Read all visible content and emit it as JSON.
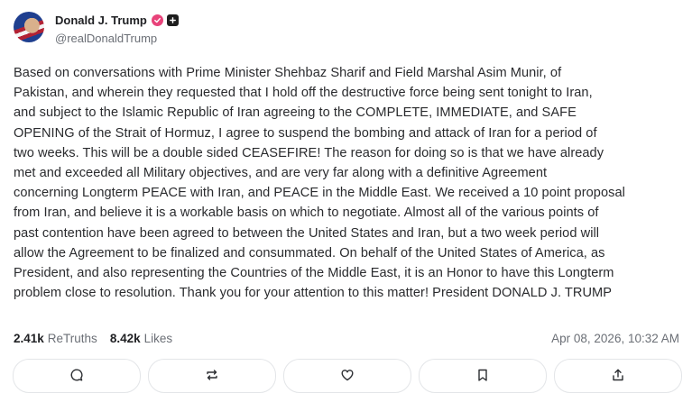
{
  "user": {
    "display_name": "Donald J. Trump",
    "handle": "@realDonaldTrump",
    "avatar_icon": "avatar-flag-portrait",
    "verified_icon": "verified-badge-icon",
    "verified_color": "#e8437a",
    "badge_icon": "plus-icon"
  },
  "post": {
    "lines": [
      "Based on conversations with Prime Minister Shehbaz Sharif and Field Marshal Asim Munir, of",
      "Pakistan, and wherein they requested that I hold off the destructive force being sent tonight to Iran,",
      "and subject to the Islamic Republic of Iran agreeing to the COMPLETE, IMMEDIATE, and SAFE",
      "OPENING of the Strait of Hormuz, I agree to suspend the bombing and attack of Iran for a period of",
      "two weeks. This will be a double sided CEASEFIRE! The reason for doing so is that we have already",
      "met and exceeded all Military objectives, and are very far along with a definitive Agreement",
      "concerning Longterm PEACE with Iran, and PEACE in the Middle East. We received a 10 point proposal",
      "from Iran, and believe it is a workable basis on which to negotiate. Almost all of the various points of",
      "past contention have been agreed to between the United States and Iran, but a two week period will",
      "allow the Agreement to be finalized and consummated. On behalf of the United States of America, as",
      "President, and also representing the Countries of the Middle East, it is an Honor to have this Longterm",
      "problem close to resolution. Thank you for your attention to this matter! President DONALD J. TRUMP"
    ]
  },
  "stats": {
    "retruths_count": "2.41k",
    "retruths_label": "ReTruths",
    "likes_count": "8.42k",
    "likes_label": "Likes",
    "timestamp": "Apr 08, 2026, 10:32 AM"
  },
  "actions": [
    {
      "icon": "reply-icon"
    },
    {
      "icon": "retruth-icon"
    },
    {
      "icon": "like-icon"
    },
    {
      "icon": "bookmark-icon"
    },
    {
      "icon": "share-icon"
    }
  ]
}
